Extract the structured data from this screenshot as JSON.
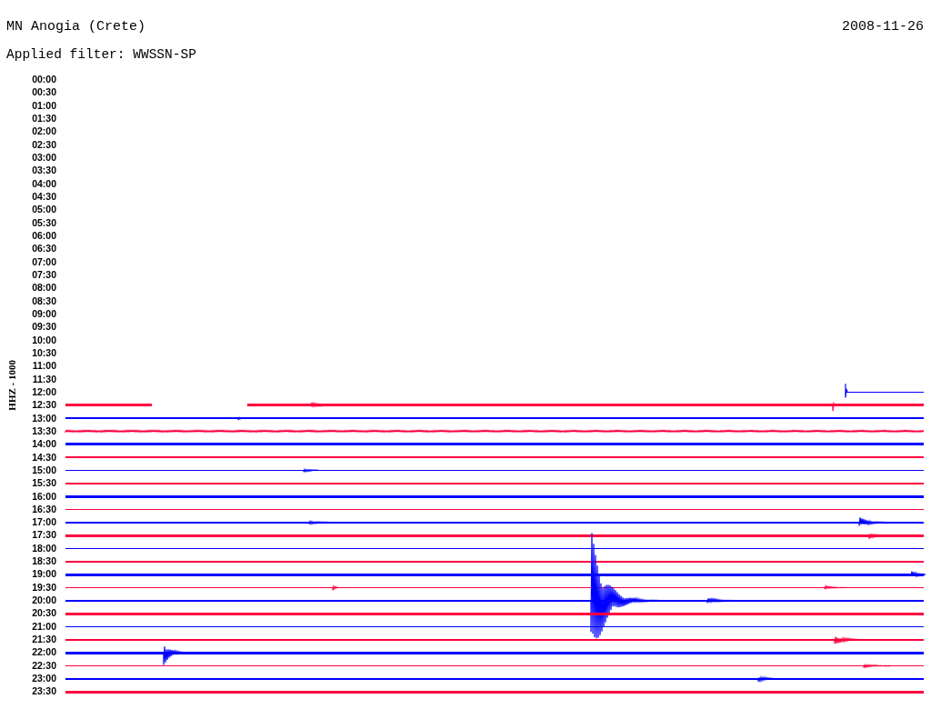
{
  "header": {
    "station": "MN Anogia (Crete)",
    "date": "2008-11-26",
    "filter": "Applied filter: WWSSN-SP"
  },
  "channel_label": "HHZ - 1000",
  "rows": [
    {
      "time": "00:00",
      "kind": "empty"
    },
    {
      "time": "00:30",
      "kind": "empty"
    },
    {
      "time": "01:00",
      "kind": "empty"
    },
    {
      "time": "01:30",
      "kind": "empty"
    },
    {
      "time": "02:00",
      "kind": "empty"
    },
    {
      "time": "02:30",
      "kind": "empty"
    },
    {
      "time": "03:00",
      "kind": "empty"
    },
    {
      "time": "03:30",
      "kind": "empty"
    },
    {
      "time": "04:00",
      "kind": "empty"
    },
    {
      "time": "04:30",
      "kind": "empty"
    },
    {
      "time": "05:00",
      "kind": "empty"
    },
    {
      "time": "05:30",
      "kind": "empty"
    },
    {
      "time": "06:00",
      "kind": "empty"
    },
    {
      "time": "06:30",
      "kind": "empty"
    },
    {
      "time": "07:00",
      "kind": "empty"
    },
    {
      "time": "07:30",
      "kind": "empty"
    },
    {
      "time": "08:00",
      "kind": "empty"
    },
    {
      "time": "08:30",
      "kind": "empty"
    },
    {
      "time": "09:00",
      "kind": "empty"
    },
    {
      "time": "09:30",
      "kind": "empty"
    },
    {
      "time": "10:00",
      "kind": "empty"
    },
    {
      "time": "10:30",
      "kind": "empty"
    },
    {
      "time": "11:00",
      "kind": "empty"
    },
    {
      "time": "11:30",
      "kind": "empty"
    },
    {
      "time": "12:00",
      "kind": "late-start",
      "color": "#0000ff",
      "thick": false
    },
    {
      "time": "12:30",
      "kind": "gap",
      "color": "#ff0040",
      "thick": true
    },
    {
      "time": "13:00",
      "kind": "trace",
      "color": "#0000ff",
      "thick": false
    },
    {
      "time": "13:30",
      "kind": "trace",
      "color": "#ff0040",
      "thick": false
    },
    {
      "time": "14:00",
      "kind": "trace",
      "color": "#0000ff",
      "thick": true
    },
    {
      "time": "14:30",
      "kind": "trace",
      "color": "#ff0040",
      "thick": false
    },
    {
      "time": "15:00",
      "kind": "trace",
      "color": "#0000ff",
      "thick": false
    },
    {
      "time": "15:30",
      "kind": "trace",
      "color": "#ff0040",
      "thick": false
    },
    {
      "time": "16:00",
      "kind": "trace",
      "color": "#0000ff",
      "thick": true
    },
    {
      "time": "16:30",
      "kind": "trace",
      "color": "#ff0040",
      "thick": false
    },
    {
      "time": "17:00",
      "kind": "trace",
      "color": "#0000ff",
      "thick": false
    },
    {
      "time": "17:30",
      "kind": "trace",
      "color": "#ff0040",
      "thick": true
    },
    {
      "time": "18:00",
      "kind": "trace",
      "color": "#0000ff",
      "thick": false
    },
    {
      "time": "18:30",
      "kind": "trace",
      "color": "#ff0040",
      "thick": false
    },
    {
      "time": "19:00",
      "kind": "trace",
      "color": "#0000ff",
      "thick": true
    },
    {
      "time": "19:30",
      "kind": "trace",
      "color": "#ff0040",
      "thick": false
    },
    {
      "time": "20:00",
      "kind": "trace",
      "color": "#0000ff",
      "thick": false
    },
    {
      "time": "20:30",
      "kind": "trace",
      "color": "#ff0040",
      "thick": true
    },
    {
      "time": "21:00",
      "kind": "trace",
      "color": "#0000ff",
      "thick": false
    },
    {
      "time": "21:30",
      "kind": "trace",
      "color": "#ff0040",
      "thick": false
    },
    {
      "time": "22:00",
      "kind": "trace",
      "color": "#0000ff",
      "thick": true
    },
    {
      "time": "22:30",
      "kind": "trace",
      "color": "#ff0040",
      "thick": false
    },
    {
      "time": "23:00",
      "kind": "trace",
      "color": "#0000ff",
      "thick": false
    },
    {
      "time": "23:30",
      "kind": "trace",
      "color": "#ff0040",
      "thick": true
    }
  ]
}
